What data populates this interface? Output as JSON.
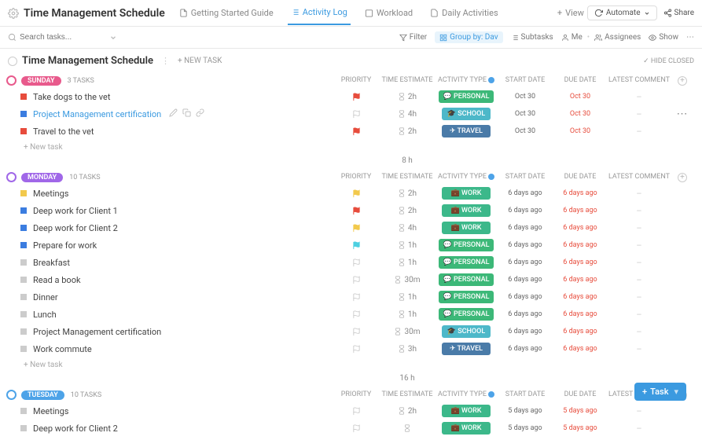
{
  "header": {
    "title": "Time Management Schedule",
    "tabs": [
      {
        "label": "Getting Started Guide",
        "active": false
      },
      {
        "label": "Activity Log",
        "active": true
      },
      {
        "label": "Workload",
        "active": false
      },
      {
        "label": "Daily Activities",
        "active": false
      }
    ],
    "view": "View",
    "automate": "Automate",
    "share": "Share"
  },
  "toolbar": {
    "search_placeholder": "Search tasks...",
    "filter": "Filter",
    "group_by": "Group by: Dav",
    "subtasks": "Subtasks",
    "me": "Me",
    "assignees": "Assignees",
    "show": "Show"
  },
  "section": {
    "title": "Time Management Schedule",
    "new_task": "+ NEW TASK",
    "hide_closed": "✓ HIDE CLOSED"
  },
  "columns": {
    "priority": "PRIORITY",
    "time_estimate": "TIME ESTIMATE",
    "activity_type": "ACTIVITY TYPE",
    "start_date": "START DATE",
    "due_date": "DUE DATE",
    "latest_comment": "LATEST COMMENT"
  },
  "labels": {
    "new_task": "+ New task"
  },
  "groups": [
    {
      "name": "SUNDAY",
      "color": "pink",
      "count": "3 TASKS",
      "total": "8 h",
      "tasks": [
        {
          "name": "Take dogs to the vet",
          "sq": "red",
          "flag": "red",
          "te": "2h",
          "type": "PERSONAL",
          "sd": "Oct 30",
          "dd": "Oct 30",
          "ddred": true,
          "active": false
        },
        {
          "name": "Project Management certification",
          "sq": "blue",
          "flag": "",
          "te": "4h",
          "type": "SCHOOL",
          "sd": "Oct 30",
          "dd": "Oct 30",
          "ddred": true,
          "active": true,
          "icons": true,
          "dots": true
        },
        {
          "name": "Travel to the vet",
          "sq": "red",
          "flag": "red",
          "te": "2h",
          "type": "TRAVEL",
          "sd": "Oct 30",
          "dd": "Oct 30",
          "ddred": true,
          "active": false
        }
      ]
    },
    {
      "name": "MONDAY",
      "color": "purple",
      "count": "10 TASKS",
      "total": "16 h",
      "tasks": [
        {
          "name": "Meetings",
          "sq": "yellow",
          "flag": "yellow",
          "te": "2h",
          "type": "WORK",
          "sd": "6 days ago",
          "dd": "6 days ago",
          "ddred": true
        },
        {
          "name": "Deep work for Client 1",
          "sq": "blue",
          "flag": "red",
          "te": "2h",
          "type": "WORK",
          "sd": "6 days ago",
          "dd": "6 days ago",
          "ddred": true
        },
        {
          "name": "Deep work for Client 2",
          "sq": "blue",
          "flag": "yellow",
          "te": "4h",
          "type": "WORK",
          "sd": "6 days ago",
          "dd": "6 days ago",
          "ddred": true
        },
        {
          "name": "Prepare for work",
          "sq": "blue",
          "flag": "cyan",
          "te": "1h",
          "type": "PERSONAL",
          "sd": "6 days ago",
          "dd": "6 days ago",
          "ddred": true
        },
        {
          "name": "Breakfast",
          "sq": "gray",
          "flag": "",
          "te": "1h",
          "type": "PERSONAL",
          "sd": "6 days ago",
          "dd": "6 days ago",
          "ddred": true
        },
        {
          "name": "Read a book",
          "sq": "gray",
          "flag": "",
          "te": "30m",
          "type": "PERSONAL",
          "sd": "6 days ago",
          "dd": "6 days ago",
          "ddred": true
        },
        {
          "name": "Dinner",
          "sq": "gray",
          "flag": "",
          "te": "1h",
          "type": "PERSONAL",
          "sd": "6 days ago",
          "dd": "6 days ago",
          "ddred": true
        },
        {
          "name": "Lunch",
          "sq": "gray",
          "flag": "",
          "te": "1h",
          "type": "PERSONAL",
          "sd": "6 days ago",
          "dd": "6 days ago",
          "ddred": true
        },
        {
          "name": "Project Management certification",
          "sq": "gray",
          "flag": "",
          "te": "30m",
          "type": "SCHOOL",
          "sd": "6 days ago",
          "dd": "6 days ago",
          "ddred": true
        },
        {
          "name": "Work commute",
          "sq": "gray",
          "flag": "",
          "te": "3h",
          "type": "TRAVEL",
          "sd": "6 days ago",
          "dd": "6 days ago",
          "ddred": true
        }
      ]
    },
    {
      "name": "TUESDAY",
      "color": "blue",
      "count": "10 TASKS",
      "total": "",
      "tasks": [
        {
          "name": "Meetings",
          "sq": "gray",
          "flag": "",
          "te": "2h",
          "type": "WORK",
          "sd": "5 days ago",
          "dd": "5 days ago",
          "ddred": true
        },
        {
          "name": "Deep work for Client 2",
          "sq": "gray",
          "flag": "",
          "te": "",
          "type": "WORK",
          "sd": "5 days ago",
          "dd": "5 days ago",
          "ddred": true
        }
      ]
    }
  ],
  "task_button": "Task"
}
